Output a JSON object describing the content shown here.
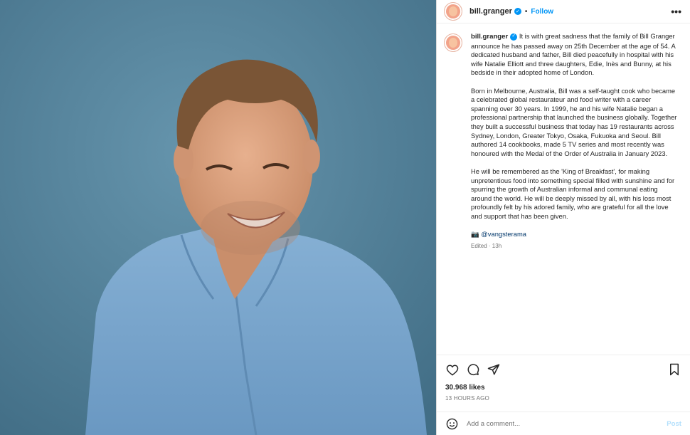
{
  "post": {
    "username": "bill.granger",
    "follow_label": "Follow",
    "more_label": "•••"
  },
  "caption": {
    "username": "bill.granger",
    "paragraphs": [
      "It is with great sadness that the family of Bill Granger announce he has passed away on 25th December at the age of 54. A dedicated husband and father, Bill died peacefully in hospital with his wife Natalie Elliott and three daughters, Edie, Inès and Bunny, at his bedside in their adopted home of London.",
      "Born in Melbourne, Australia, Bill was a self-taught cook who became a celebrated global restaurateur and food writer with a career spanning over 30 years. In 1999, he and his wife Natalie began a professional partnership that launched the business globally. Together they built a successful business that today has 19 restaurants across Sydney, London, Greater Tokyo, Osaka, Fukuoka and Seoul. Bill authored 14 cookbooks, made 5 TV series and most recently was honoured with the Medal of the Order of Australia in January 2023.",
      "He will be remembered as the 'King of Breakfast', for making unpretentious food into something special filled with sunshine and for spurring the growth of Australian informal and communal eating around the world. He will be deeply missed by all, with his loss most profoundly felt by his adored family, who are grateful for all the love and support that has been given."
    ],
    "credit": "📷 @vangsterama",
    "edited": "Edited · 13h"
  },
  "stats": {
    "likes": "30.968 likes",
    "time_ago": "13 HOURS AGO"
  },
  "comment": {
    "placeholder": "Add a comment...",
    "post_label": "Post"
  },
  "icons": {
    "like": "heart-icon",
    "comment": "comment-icon",
    "share": "share-icon",
    "save": "bookmark-icon",
    "emoji": "emoji-icon"
  },
  "colors": {
    "accent": "#0095f6",
    "photo_background": "#4f7f99",
    "shirt": "#7fa9cf"
  }
}
